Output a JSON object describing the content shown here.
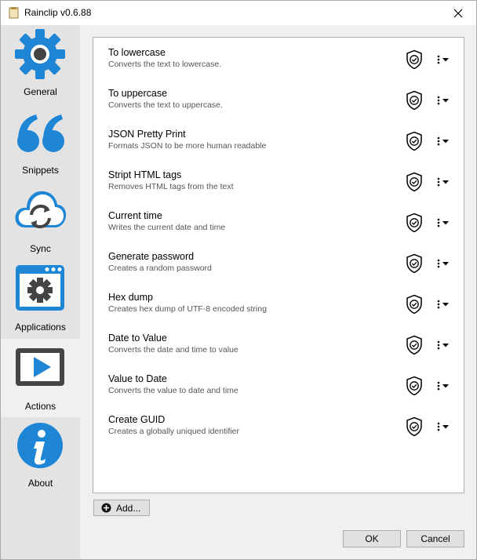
{
  "window": {
    "title": "Rainclip v0.6.88"
  },
  "sidebar": {
    "items": [
      {
        "label": "General",
        "icon": "gear-icon"
      },
      {
        "label": "Snippets",
        "icon": "quote-icon"
      },
      {
        "label": "Sync",
        "icon": "cloud-sync-icon"
      },
      {
        "label": "Applications",
        "icon": "app-window-gear-icon"
      },
      {
        "label": "Actions",
        "icon": "play-icon"
      },
      {
        "label": "About",
        "icon": "info-icon"
      }
    ],
    "active": "Actions"
  },
  "actions": [
    {
      "name": "To lowercase",
      "description": "Converts the text to lowercase."
    },
    {
      "name": "To uppercase",
      "description": "Converts the text to uppercase."
    },
    {
      "name": "JSON Pretty Print",
      "description": "Formats JSON to be more human readable"
    },
    {
      "name": "Stript HTML tags",
      "description": "Removes HTML tags from the text"
    },
    {
      "name": "Current time",
      "description": "Writes the current date and time"
    },
    {
      "name": "Generate password",
      "description": "Creates a random password"
    },
    {
      "name": "Hex dump",
      "description": "Creates hex dump of UTF-8 encoded string"
    },
    {
      "name": "Date to Value",
      "description": "Converts the date and time to value"
    },
    {
      "name": "Value to Date",
      "description": "Converts the value to date and time"
    },
    {
      "name": "Create GUID",
      "description": "Creates a globally uniqued identifier"
    }
  ],
  "buttons": {
    "add": "Add...",
    "ok": "OK",
    "cancel": "Cancel"
  },
  "colors": {
    "accent_blue": "#1f86d6",
    "sidebar_bg": "#e3e3e3",
    "active_bg": "#f0f0f0"
  }
}
